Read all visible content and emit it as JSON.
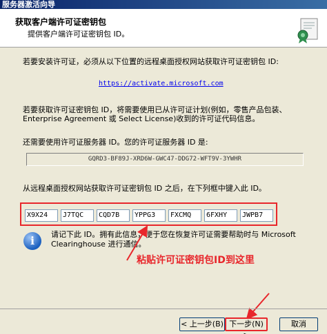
{
  "window": {
    "title": "服务器激活向导"
  },
  "header": {
    "title": "获取客户端许可证密钥包",
    "subtitle": "提供客户端许可证密钥包 ID。"
  },
  "content": {
    "instruction1": "若要安装许可证，必须从以下位置的远程桌面授权网站获取许可证密钥包 ID:",
    "link": "https://activate.microsoft.com",
    "instruction2_line1": "若要获取许可证密钥包 ID，将需要使用已从许可证计划(例如，零售产品包装、",
    "instruction2_line2": "Enterprise Agreement 或 Select License)收到的许可证代码信息。",
    "server_id_label": "还需要使用许可证服务器 ID。您的许可证服务器 ID 是:",
    "server_id": "GQRD3-BF89J-XRD6W-GWC47-DDG72-WFT9V-3YWHR",
    "key_pack_label": "从远程桌面授权网站获取许可证密钥包 ID 之后，在下列框中键入此 ID。",
    "key_pack_fields": [
      "X9X24",
      "J7TQC",
      "CQD7B",
      "YPPG3",
      "FXCMQ",
      "6FXHY",
      "JWPB7"
    ],
    "info_line1": "请记下此 ID。拥有此信息，便于您在恢复许可证需要帮助时与 Microsoft",
    "info_line2": "Clearinghouse 进行通信。",
    "annotation": "粘贴许可证密钥包ID到这里"
  },
  "footer": {
    "back_label": "< 上一步(B)",
    "next_label": "下一步(N) >",
    "cancel_label": "取消"
  },
  "colors": {
    "annotation": "#e8262b",
    "titlebar": "#0a246a"
  }
}
